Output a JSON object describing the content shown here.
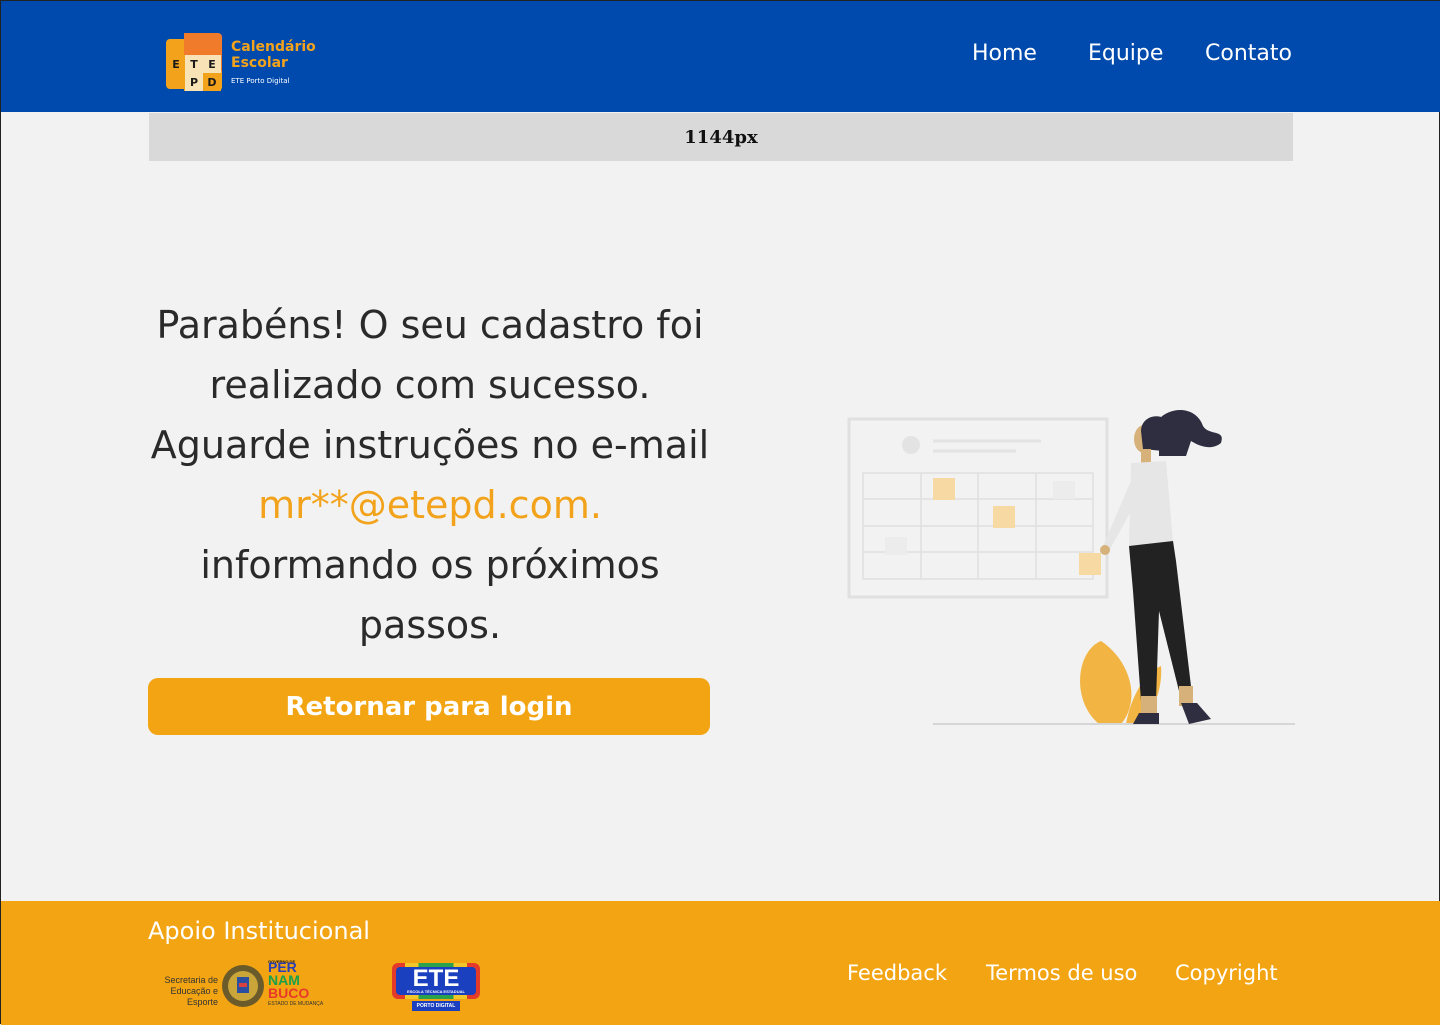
{
  "header": {
    "logo": {
      "letters": [
        "E",
        "T",
        "E",
        "P",
        "D"
      ],
      "title_line1": "Calendário",
      "title_line2": "Escolar",
      "subtitle": "ETE Porto Digital"
    },
    "nav": [
      {
        "label": "Home"
      },
      {
        "label": "Equipe"
      },
      {
        "label": "Contato"
      }
    ]
  },
  "width_indicator": "1144px",
  "message": {
    "part1": "Parabéns! O seu cadastro foi realizado com sucesso. Aguarde instruções no e-mail ",
    "email": "mr**@etepd.com.",
    "part2": " informando os próximos passos."
  },
  "login_button": "Retornar para login",
  "footer": {
    "title": "Apoio Institucional",
    "secretaria": "Secretaria de Educação e Esporte",
    "pernambuco": {
      "top": "GOVERNO DE",
      "l1": "PER",
      "l2": "NAM",
      "l3": "BUCO",
      "sub": "ESTADO DE MUDANÇA"
    },
    "ete": {
      "label": "ETE",
      "sub1": "ESCOLA TÉCNICA ESTADUAL",
      "sub2": "PORTO DIGITAL"
    },
    "links": [
      {
        "label": "Feedback"
      },
      {
        "label": "Termos de uso"
      },
      {
        "label": "Copyright"
      }
    ]
  },
  "colors": {
    "header_bg": "#004aad",
    "accent": "#f2a412",
    "page_bg": "#f2f2f2"
  }
}
